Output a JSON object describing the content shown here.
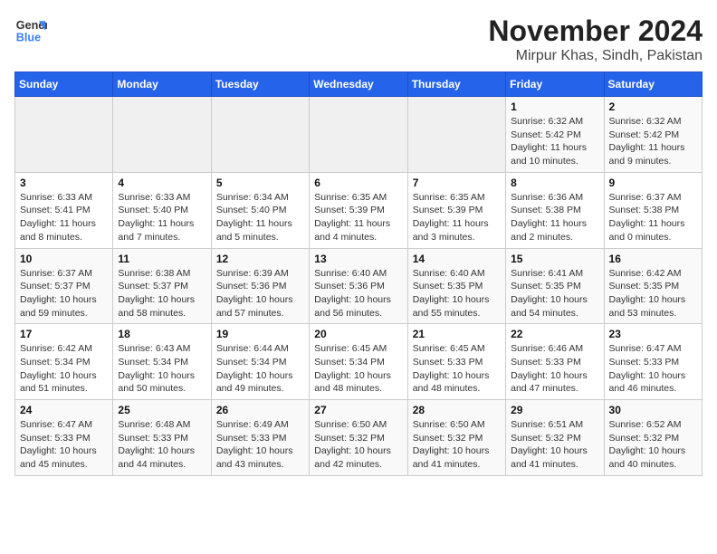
{
  "logo": {
    "line1": "General",
    "line2": "Blue"
  },
  "title": "November 2024",
  "location": "Mirpur Khas, Sindh, Pakistan",
  "weekdays": [
    "Sunday",
    "Monday",
    "Tuesday",
    "Wednesday",
    "Thursday",
    "Friday",
    "Saturday"
  ],
  "weeks": [
    [
      {
        "day": "",
        "info": ""
      },
      {
        "day": "",
        "info": ""
      },
      {
        "day": "",
        "info": ""
      },
      {
        "day": "",
        "info": ""
      },
      {
        "day": "",
        "info": ""
      },
      {
        "day": "1",
        "info": "Sunrise: 6:32 AM\nSunset: 5:42 PM\nDaylight: 11 hours and 10 minutes."
      },
      {
        "day": "2",
        "info": "Sunrise: 6:32 AM\nSunset: 5:42 PM\nDaylight: 11 hours and 9 minutes."
      }
    ],
    [
      {
        "day": "3",
        "info": "Sunrise: 6:33 AM\nSunset: 5:41 PM\nDaylight: 11 hours and 8 minutes."
      },
      {
        "day": "4",
        "info": "Sunrise: 6:33 AM\nSunset: 5:40 PM\nDaylight: 11 hours and 7 minutes."
      },
      {
        "day": "5",
        "info": "Sunrise: 6:34 AM\nSunset: 5:40 PM\nDaylight: 11 hours and 5 minutes."
      },
      {
        "day": "6",
        "info": "Sunrise: 6:35 AM\nSunset: 5:39 PM\nDaylight: 11 hours and 4 minutes."
      },
      {
        "day": "7",
        "info": "Sunrise: 6:35 AM\nSunset: 5:39 PM\nDaylight: 11 hours and 3 minutes."
      },
      {
        "day": "8",
        "info": "Sunrise: 6:36 AM\nSunset: 5:38 PM\nDaylight: 11 hours and 2 minutes."
      },
      {
        "day": "9",
        "info": "Sunrise: 6:37 AM\nSunset: 5:38 PM\nDaylight: 11 hours and 0 minutes."
      }
    ],
    [
      {
        "day": "10",
        "info": "Sunrise: 6:37 AM\nSunset: 5:37 PM\nDaylight: 10 hours and 59 minutes."
      },
      {
        "day": "11",
        "info": "Sunrise: 6:38 AM\nSunset: 5:37 PM\nDaylight: 10 hours and 58 minutes."
      },
      {
        "day": "12",
        "info": "Sunrise: 6:39 AM\nSunset: 5:36 PM\nDaylight: 10 hours and 57 minutes."
      },
      {
        "day": "13",
        "info": "Sunrise: 6:40 AM\nSunset: 5:36 PM\nDaylight: 10 hours and 56 minutes."
      },
      {
        "day": "14",
        "info": "Sunrise: 6:40 AM\nSunset: 5:35 PM\nDaylight: 10 hours and 55 minutes."
      },
      {
        "day": "15",
        "info": "Sunrise: 6:41 AM\nSunset: 5:35 PM\nDaylight: 10 hours and 54 minutes."
      },
      {
        "day": "16",
        "info": "Sunrise: 6:42 AM\nSunset: 5:35 PM\nDaylight: 10 hours and 53 minutes."
      }
    ],
    [
      {
        "day": "17",
        "info": "Sunrise: 6:42 AM\nSunset: 5:34 PM\nDaylight: 10 hours and 51 minutes."
      },
      {
        "day": "18",
        "info": "Sunrise: 6:43 AM\nSunset: 5:34 PM\nDaylight: 10 hours and 50 minutes."
      },
      {
        "day": "19",
        "info": "Sunrise: 6:44 AM\nSunset: 5:34 PM\nDaylight: 10 hours and 49 minutes."
      },
      {
        "day": "20",
        "info": "Sunrise: 6:45 AM\nSunset: 5:34 PM\nDaylight: 10 hours and 48 minutes."
      },
      {
        "day": "21",
        "info": "Sunrise: 6:45 AM\nSunset: 5:33 PM\nDaylight: 10 hours and 48 minutes."
      },
      {
        "day": "22",
        "info": "Sunrise: 6:46 AM\nSunset: 5:33 PM\nDaylight: 10 hours and 47 minutes."
      },
      {
        "day": "23",
        "info": "Sunrise: 6:47 AM\nSunset: 5:33 PM\nDaylight: 10 hours and 46 minutes."
      }
    ],
    [
      {
        "day": "24",
        "info": "Sunrise: 6:47 AM\nSunset: 5:33 PM\nDaylight: 10 hours and 45 minutes."
      },
      {
        "day": "25",
        "info": "Sunrise: 6:48 AM\nSunset: 5:33 PM\nDaylight: 10 hours and 44 minutes."
      },
      {
        "day": "26",
        "info": "Sunrise: 6:49 AM\nSunset: 5:33 PM\nDaylight: 10 hours and 43 minutes."
      },
      {
        "day": "27",
        "info": "Sunrise: 6:50 AM\nSunset: 5:32 PM\nDaylight: 10 hours and 42 minutes."
      },
      {
        "day": "28",
        "info": "Sunrise: 6:50 AM\nSunset: 5:32 PM\nDaylight: 10 hours and 41 minutes."
      },
      {
        "day": "29",
        "info": "Sunrise: 6:51 AM\nSunset: 5:32 PM\nDaylight: 10 hours and 41 minutes."
      },
      {
        "day": "30",
        "info": "Sunrise: 6:52 AM\nSunset: 5:32 PM\nDaylight: 10 hours and 40 minutes."
      }
    ]
  ]
}
